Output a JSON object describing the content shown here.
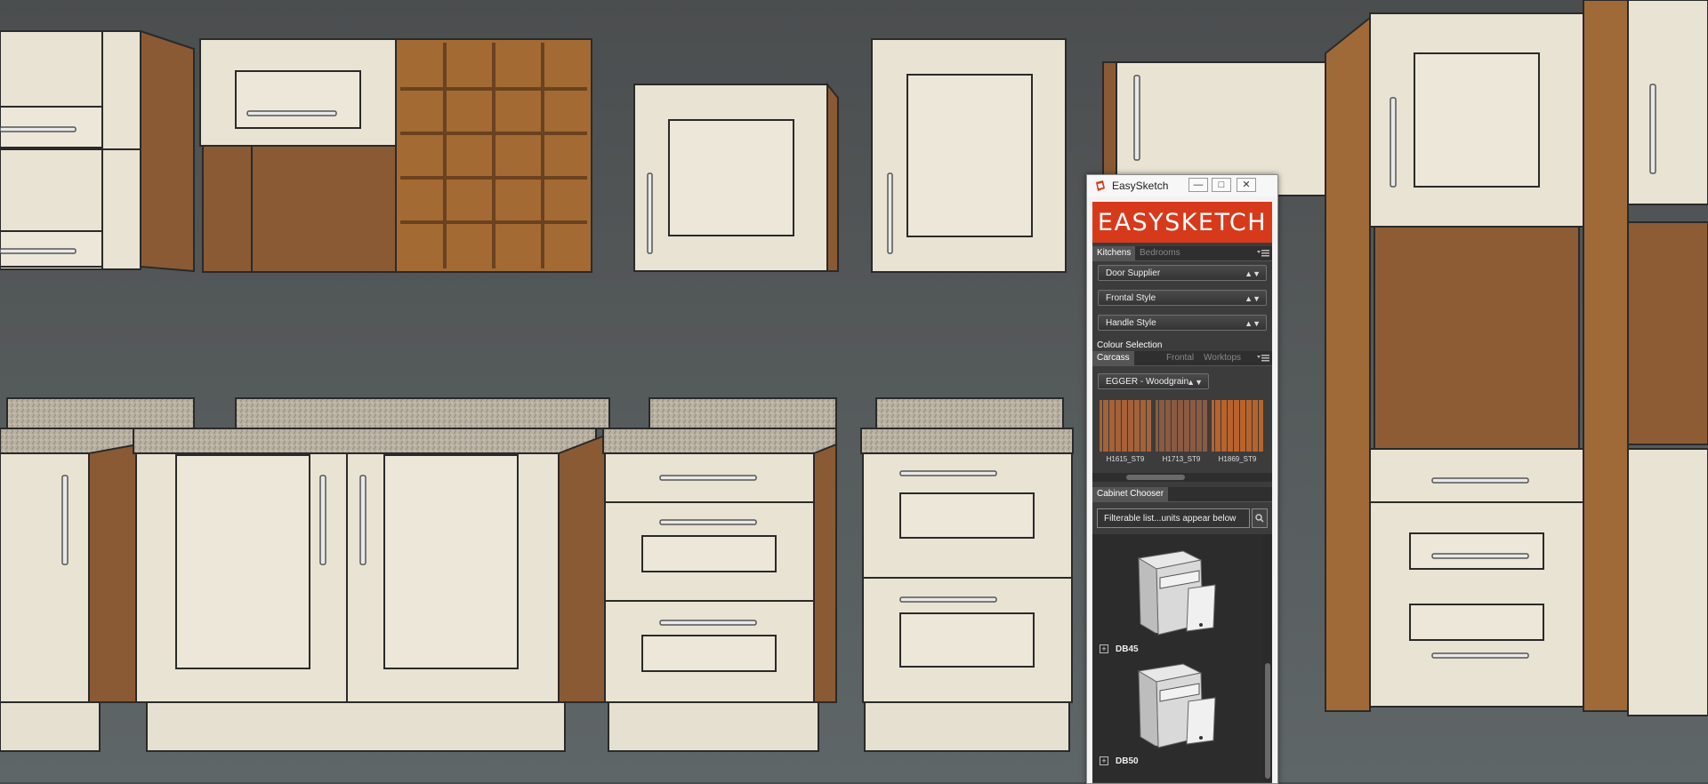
{
  "window": {
    "title": "EasySketch"
  },
  "brand": {
    "text": "EASYSKETCH",
    "color": "#d63a1b"
  },
  "tabs_main": [
    {
      "label": "Kitchens",
      "active": true
    },
    {
      "label": "Bedrooms",
      "active": false
    }
  ],
  "selects": {
    "door_supplier": "Door Supplier",
    "frontal_style": "Frontal Style",
    "handle_style": "Handle Style"
  },
  "colour_selection": {
    "label": "Colour Selection",
    "tabs": [
      {
        "label": "Carcass",
        "active": true
      },
      {
        "label": "Frontal",
        "active": false
      },
      {
        "label": "Worktops",
        "active": false
      }
    ],
    "material": "EGGER - Woodgrain",
    "swatches": [
      {
        "code": "H1615_ST9",
        "color": "#a5623a"
      },
      {
        "code": "H1713_ST9",
        "color": "#8b5a42"
      },
      {
        "code": "H1869_ST9",
        "color": "#b8632c"
      }
    ]
  },
  "cabinet_chooser": {
    "label": "Cabinet Chooser",
    "search_placeholder": "Filterable list...units appear below",
    "items": [
      {
        "code": "DB45"
      },
      {
        "code": "DB50"
      }
    ]
  },
  "icons": [
    "sketchup-icon",
    "minimize-icon",
    "maximize-icon",
    "close-icon",
    "panel-menu-icon",
    "search-icon",
    "expand-icon"
  ]
}
